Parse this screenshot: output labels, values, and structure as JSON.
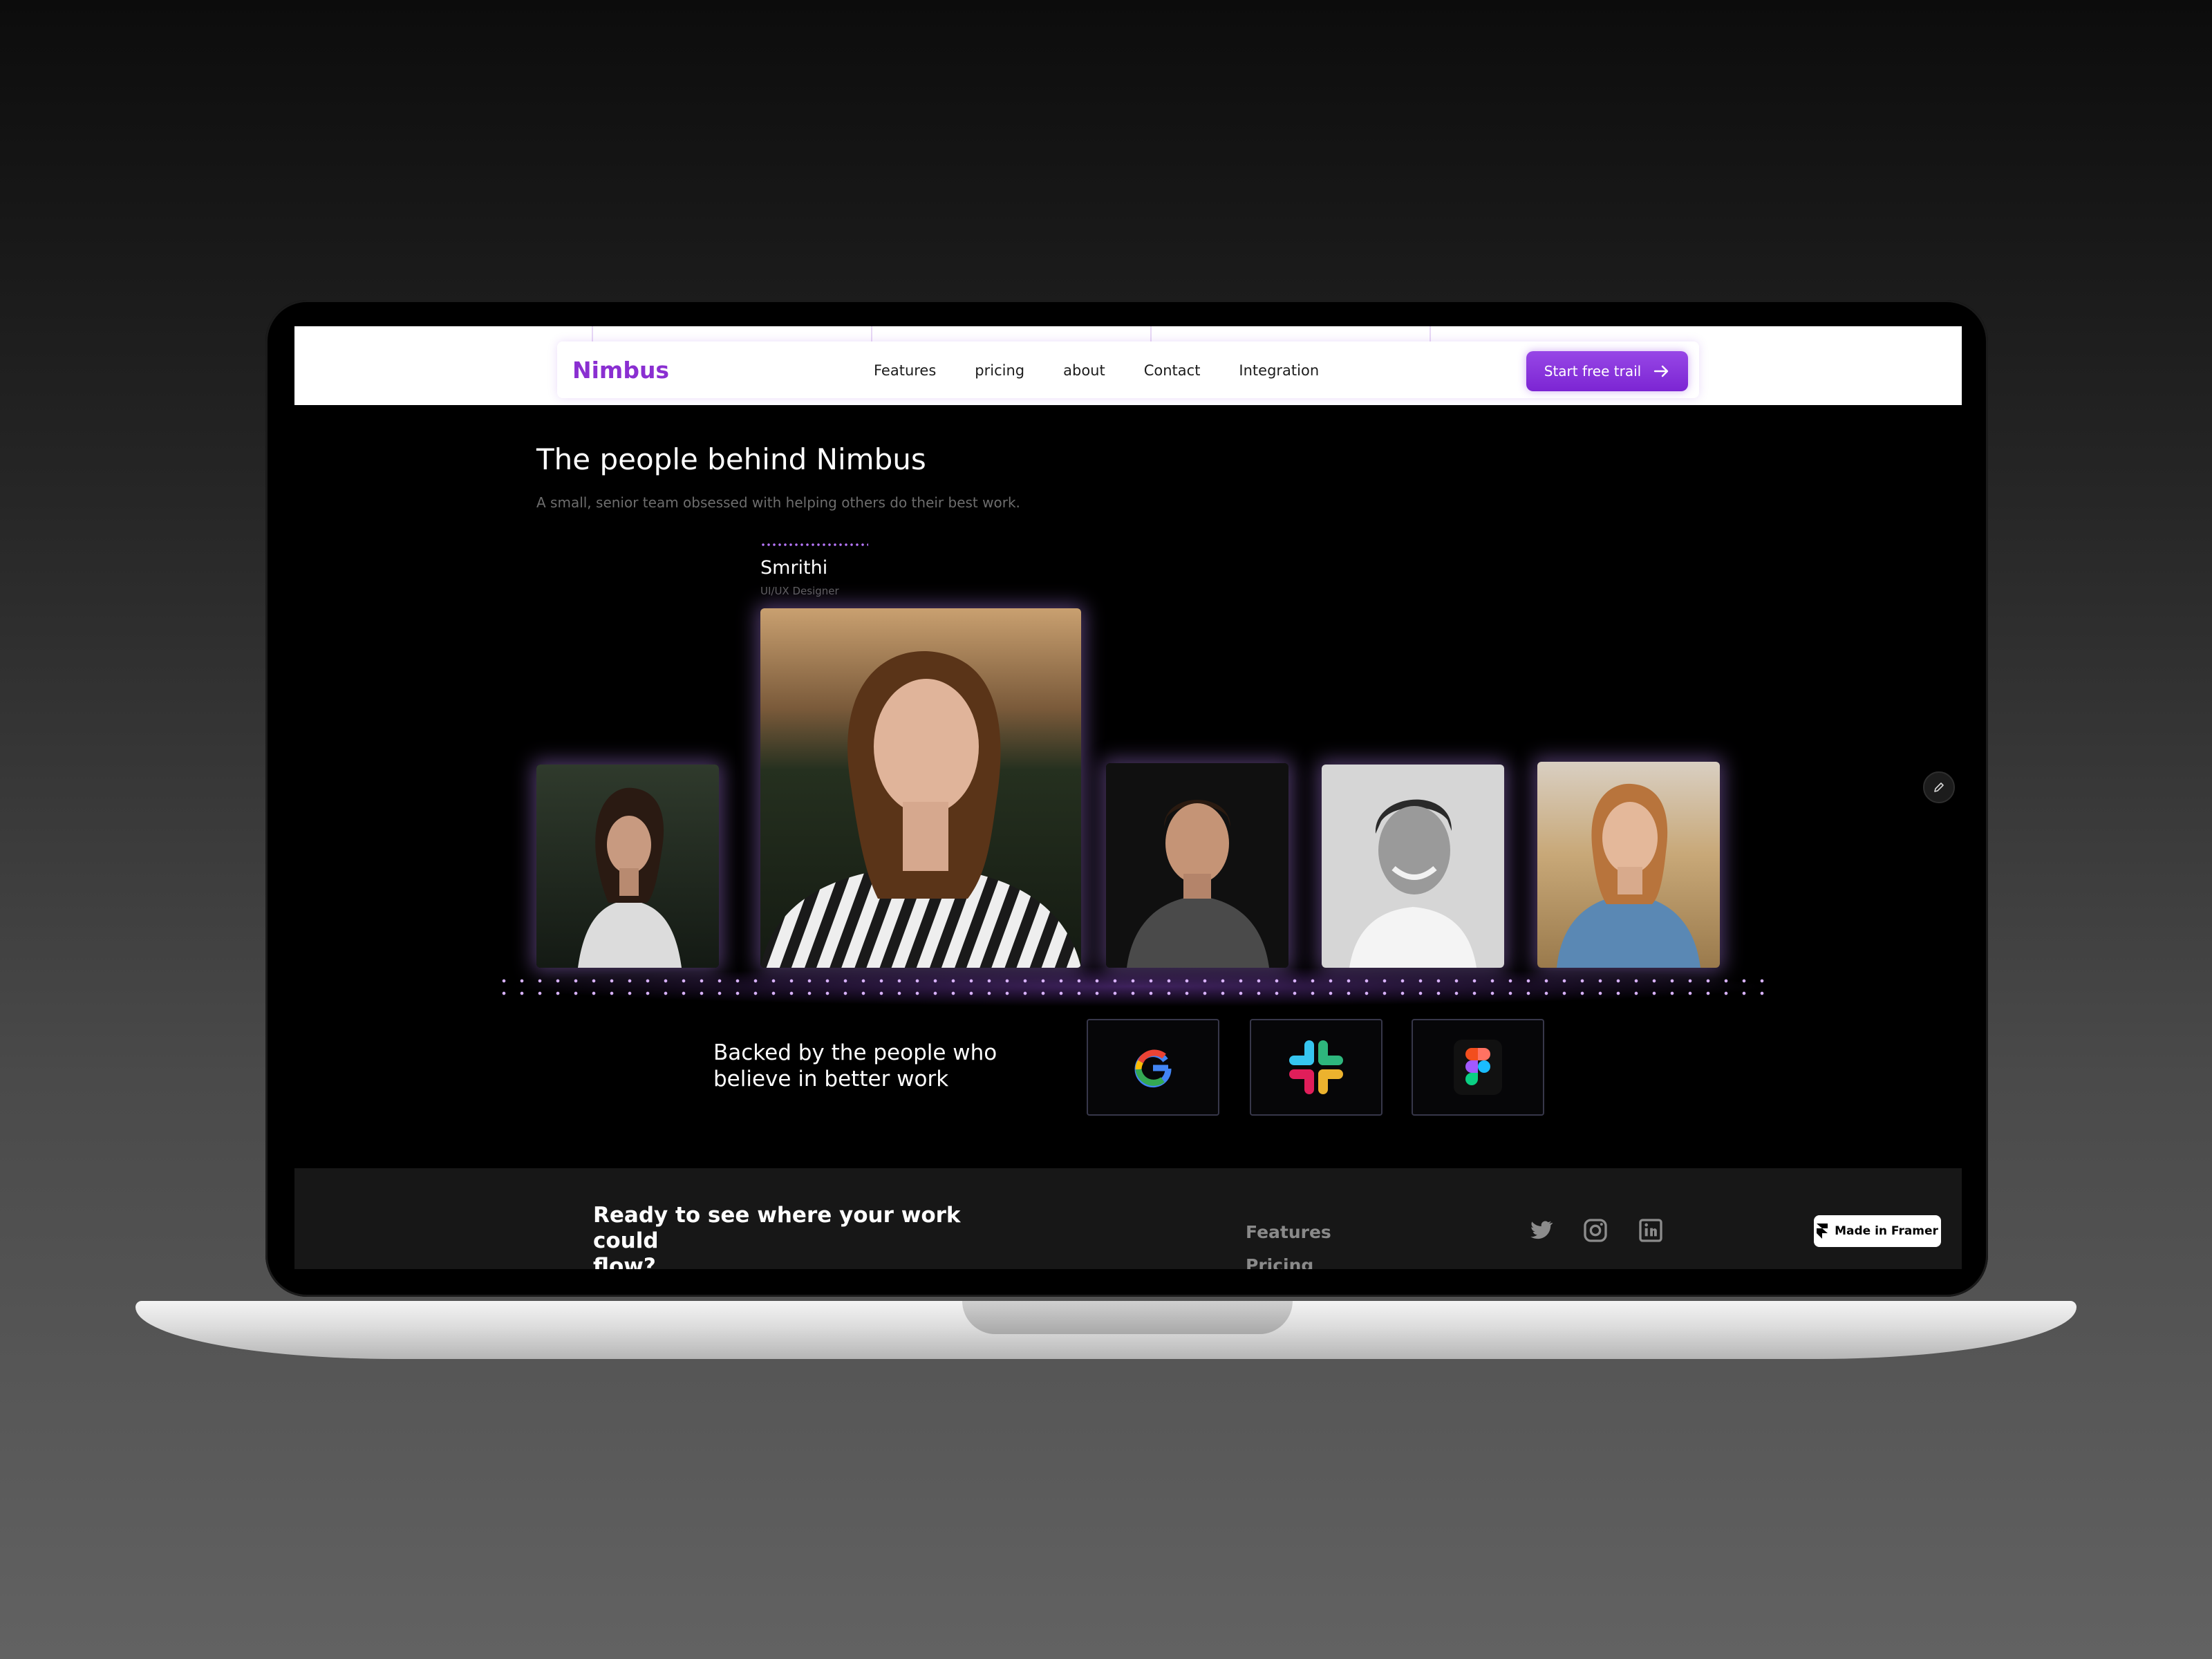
{
  "nav": {
    "logo": "Nimbus",
    "links": [
      "Features",
      "pricing",
      "about",
      "Contact",
      "Integration"
    ],
    "cta_label": "Start free trail"
  },
  "hero": {
    "title": "The people behind Nimbus",
    "subtitle": "A small, senior team obsessed with helping others do their best work.",
    "featured_member": {
      "name": "Smrithi",
      "role": "UI/UX Designer"
    }
  },
  "backers": {
    "text_line1": "Backed by the people who",
    "text_line2": "believe in better work",
    "logos": [
      "google-icon",
      "slack-icon",
      "figma-icon"
    ]
  },
  "footer": {
    "cta_line1": "Ready to see where your work could",
    "cta_line2": "flow?",
    "links": [
      "Features",
      "Pricing"
    ],
    "social": [
      "twitter-icon",
      "instagram-icon",
      "linkedin-icon"
    ],
    "badge": "Made in Framer"
  },
  "colors": {
    "accent": "#8a2fd1",
    "glow": "#b877ff",
    "background": "#000000"
  }
}
